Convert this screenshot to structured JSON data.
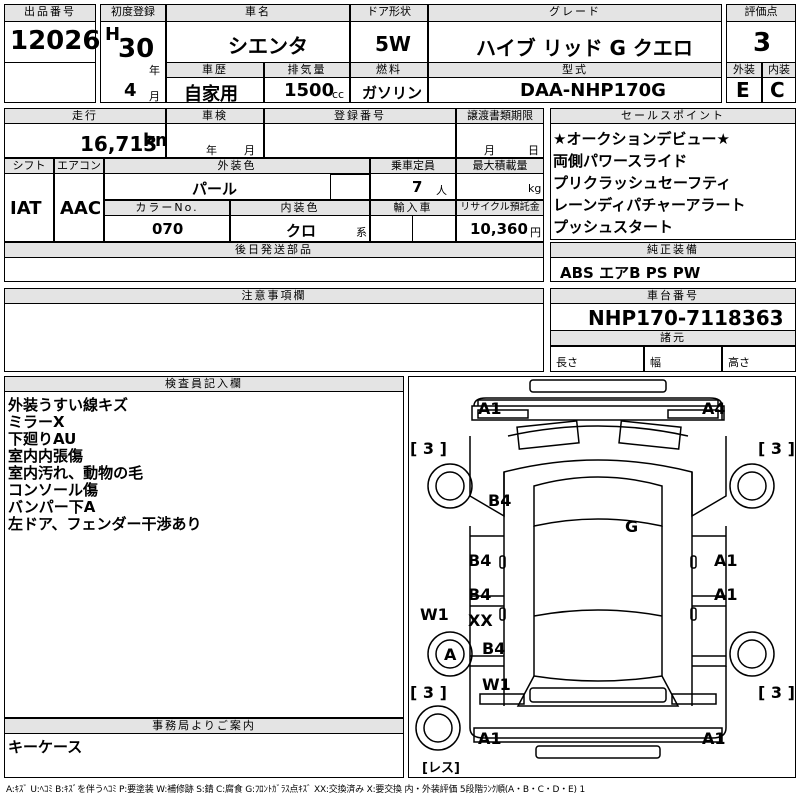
{
  "header": {
    "lot_label": "出品番号",
    "lot_value": "12026",
    "first_reg_label": "初度登録",
    "era": "H",
    "year": "30",
    "year_unit": "年",
    "month": "4",
    "month_unit": "月",
    "car_name_label": "車名",
    "car_name": "シエンタ",
    "door_label": "ドア形状",
    "door": "5W",
    "grade_label": "グレード",
    "grade": "ハイブ リッド G クエロ",
    "score_label": "評価点",
    "score": "3",
    "history_label": "車歴",
    "history": "自家用",
    "disp_label": "排気量",
    "disp": "1500",
    "disp_unit": "cc",
    "fuel_label": "燃料",
    "fuel": "ガソリン",
    "model_label": "型式",
    "model": "DAA-NHP170G",
    "ext_label": "外装",
    "ext": "E",
    "int_label": "内装",
    "int": "C"
  },
  "row2": {
    "mileage_label": "走行",
    "mileage": "16,713",
    "mileage_unit": "km",
    "inspection_label": "車検",
    "year_unit": "年",
    "month_unit": "月",
    "regno_label": "登録番号",
    "deadline_label": "譲渡書類期限",
    "deadline_month_unit": "月",
    "deadline_day_unit": "日",
    "shift_label": "シフト",
    "shift": "IAT",
    "ac_label": "エアコン",
    "ac": "AAC",
    "color_label": "外装色",
    "color": "パール",
    "seats_label": "乗車定員",
    "seats": "7",
    "seats_unit": "人",
    "load_label": "最大積載量",
    "load_unit": "kg",
    "colorno_label": "カラーNo.",
    "colorno": "070",
    "intcolor_label": "内装色",
    "intcolor": "クロ",
    "intcolor_unit": "系",
    "import_label": "輸入車",
    "recycle_label": "リサイクル預託金",
    "recycle": "10,360",
    "recycle_unit": "円",
    "later_label": "後日発送部品"
  },
  "sales_points": {
    "label": "セールスポイント",
    "items": [
      "★オークションデビュー★",
      "両側パワースライド",
      "プリクラッシュセーフティ",
      "レーンディパチャーアラート",
      "プッシュスタート"
    ]
  },
  "equipment": {
    "label": "純正装備",
    "value": "ABS エアB PS PW"
  },
  "notes": {
    "label": "注意事項欄"
  },
  "chassis": {
    "label": "車台番号",
    "value": "NHP170-7118363",
    "spec_label": "諸元",
    "length_label": "長さ",
    "width_label": "幅",
    "height_label": "高さ"
  },
  "inspector": {
    "label": "検査員記入欄",
    "lines": [
      "外装うすい線キズ",
      "ミラーX",
      "下廻りAU",
      "室内内張傷",
      "室内汚れ、動物の毛",
      "コンソール傷",
      "バンパー下A",
      "左ドア、フェンダー干渉あり"
    ]
  },
  "office": {
    "label": "事務局よりご案内",
    "value": "キーケース"
  },
  "diagram": {
    "marks": {
      "a1_fl": "A1",
      "a4_fr": "A4",
      "b4_hood": "B4",
      "g_glass": "G",
      "b4_l1": "B4",
      "a1_r1": "A1",
      "b4_l2": "B4",
      "xx_l": "XX",
      "a1_r2": "A1",
      "w1_l": "W1",
      "b4_l3": "B4",
      "a_wheel": "A",
      "w1_rear": "W1",
      "a1_rl": "A1",
      "a1_rr": "A1"
    },
    "tire_marks": [
      "[ 3 ]",
      "[ 3 ]",
      "[ 3 ]",
      "[ 3 ]"
    ],
    "spare": "[レス]"
  },
  "legend": "A:ｷｽﾞ U:ﾍｺﾐ B:ｷｽﾞを伴うﾍｺﾐ P:要塗装 W:補修跡 S:錆 C:腐食 G:ﾌﾛﾝﾄｶﾞﾗｽ点ｷｽﾞ XX:交換済み X:要交換 内・外装評価 5段階ﾗﾝｸ順(A・B・C・D・E) 1"
}
